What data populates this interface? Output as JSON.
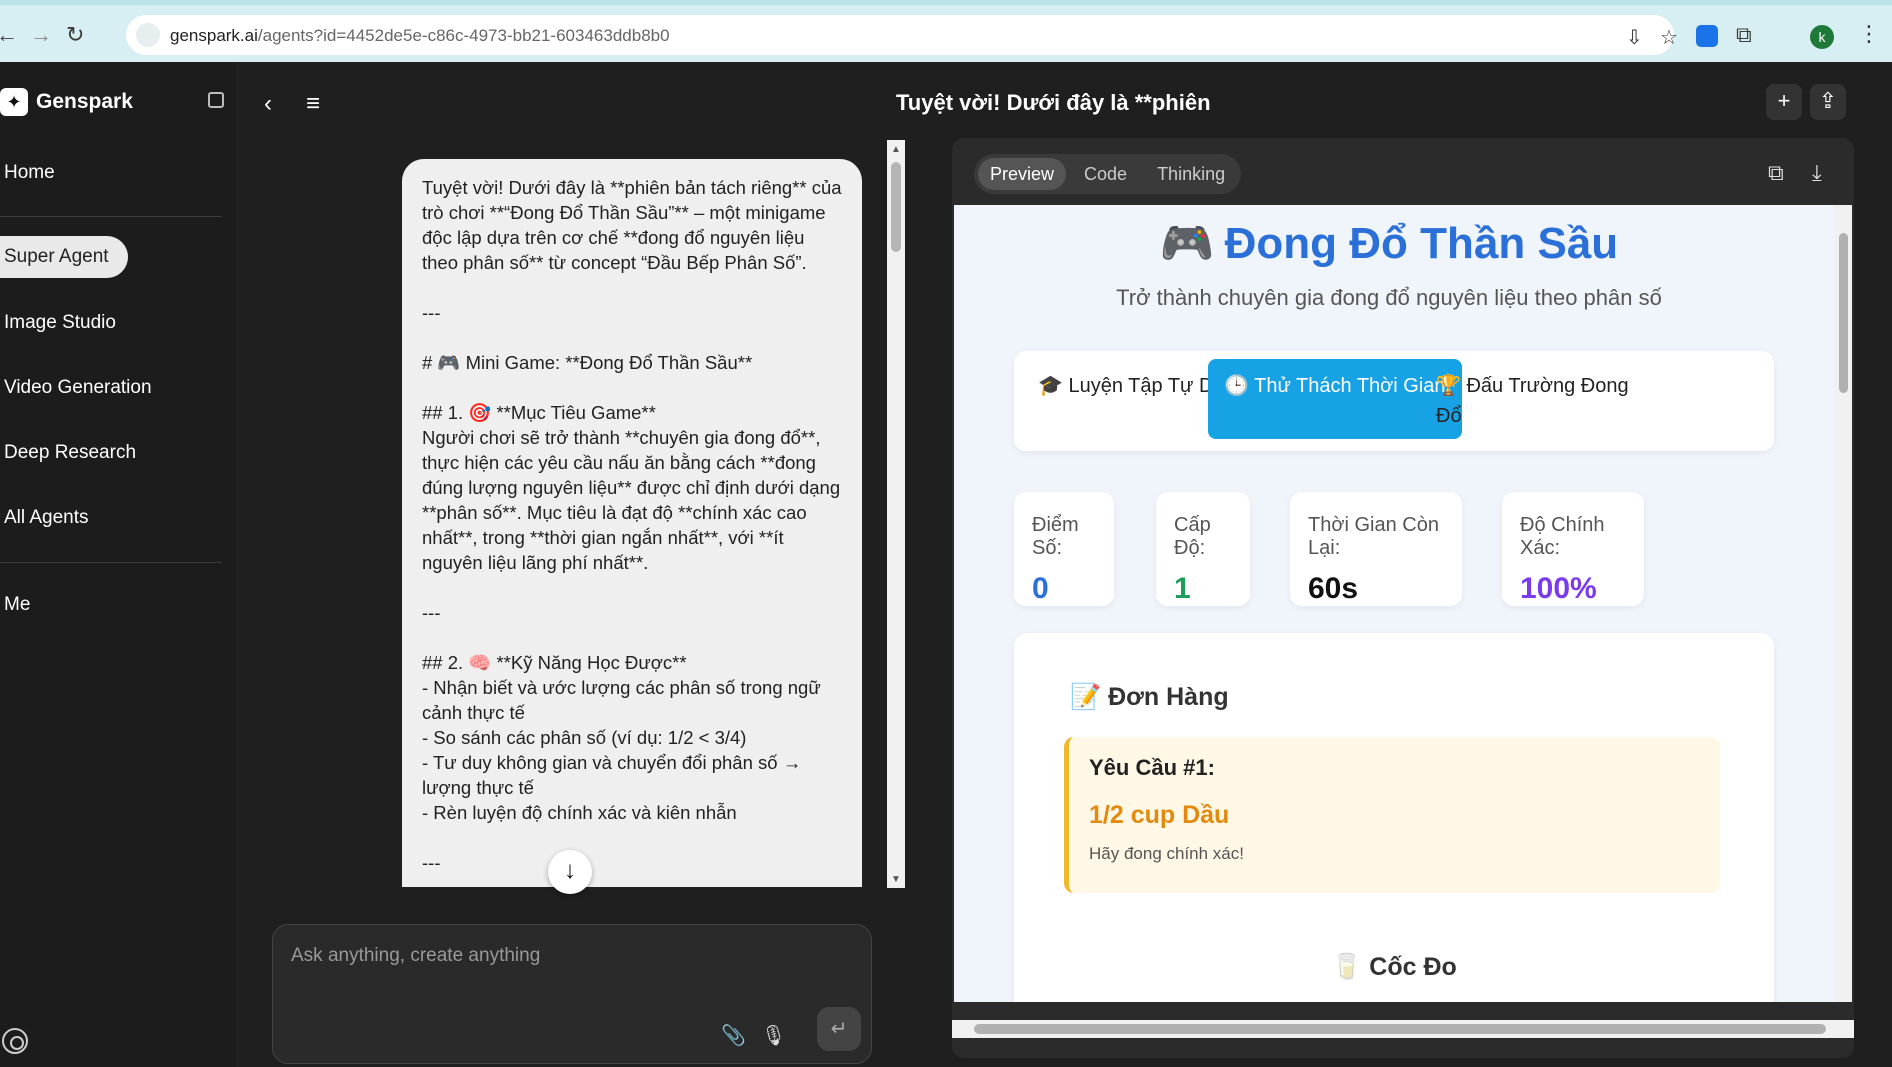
{
  "browser": {
    "url_domain": "genspark.ai",
    "url_path": "/agents?id=4452de5e-c86c-4973-bb21-603463ddb8b0",
    "profile_initial": "k"
  },
  "sidebar": {
    "brand": "Genspark",
    "items": [
      {
        "label": "Home"
      },
      {
        "label": "Super Agent"
      },
      {
        "label": "Image Studio"
      },
      {
        "label": "Video Generation"
      },
      {
        "label": "Deep Research"
      },
      {
        "label": "All Agents"
      },
      {
        "label": "Me"
      }
    ]
  },
  "chat": {
    "title": "Tuyệt vời! Dưới đây là **phiên",
    "message": "Tuyệt vời! Dưới đây là **phiên bản tách riêng** của trò chơi **“Đong Đổ Thần Sầu”** – một minigame độc lập dựa trên cơ chế **đong đổ nguyên liệu theo phân số** từ concept “Đầu Bếp Phân Số”.\n\n---\n\n# 🎮 Mini Game: **Đong Đổ Thần Sầu**\n\n## 1. 🎯 **Mục Tiêu Game**\nNgười chơi sẽ trở thành **chuyên gia đong đổ**, thực hiện các yêu cầu nấu ăn bằng cách **đong đúng lượng nguyên liệu** được chỉ định dưới dạng **phân số**. Mục tiêu là đạt độ **chính xác cao nhất**, trong **thời gian ngắn nhất**, với **ít nguyên liệu lãng phí nhất**.\n\n---\n\n## 2. 🧠 **Kỹ Năng Học Được**\n- Nhận biết và ước lượng các phân số trong ngữ cảnh thực tế\n- So sánh các phân số (ví dụ: 1/2 < 3/4)\n- Tư duy không gian và chuyển đổi phân số → lượng thực tế\n- Rèn luyện độ chính xác và kiên nhẫn\n\n---",
    "input_placeholder": "Ask anything, create anything"
  },
  "preview": {
    "tabs": [
      "Preview",
      "Code",
      "Thinking"
    ],
    "active_tab": "Preview",
    "game": {
      "title": "Đong Đổ Thần Sầu",
      "subtitle": "Trở thành chuyên gia đong đổ nguyên liệu theo phân số",
      "modes": [
        {
          "label": "Luyện Tập Tự Do",
          "icon": "graduation-cap-icon"
        },
        {
          "label": "Thử Thách Thời Gian",
          "icon": "clock-icon"
        },
        {
          "label": "Đấu Trường Đong Đổ",
          "icon": "trophy-icon"
        }
      ],
      "active_mode": "Thử Thách Thời Gian",
      "stats": [
        {
          "label": "Điểm Số:",
          "value": "0",
          "color": "#2b6fd8"
        },
        {
          "label": "Cấp Độ:",
          "value": "1",
          "color": "#1e9e5a"
        },
        {
          "label": "Thời Gian Còn Lại:",
          "value": "60s",
          "color": "#111111"
        },
        {
          "label": "Độ Chính Xác:",
          "value": "100%",
          "color": "#7c3aed"
        }
      ],
      "order": {
        "heading": "Đơn Hàng",
        "request": "Yêu Cầu #1:",
        "amount": "1/2 cup Dầu",
        "hint": "Hãy đong chính xác!"
      },
      "cup_heading": "Cốc Đo"
    }
  },
  "colors": {
    "accent_blue": "#17a2e6",
    "title_blue": "#2b6fd8",
    "order_orange": "#e38a0e"
  }
}
